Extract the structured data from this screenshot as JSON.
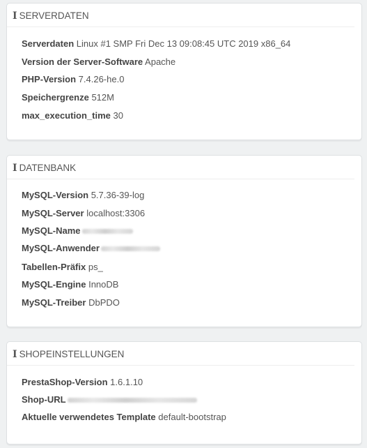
{
  "server": {
    "title": "SERVERDATEN",
    "rows": [
      {
        "label": "Serverdaten",
        "value": "Linux #1 SMP Fri Dec 13 09:08:45 UTC 2019 x86_64"
      },
      {
        "label": "Version der Server-Software",
        "value": "Apache"
      },
      {
        "label": "PHP-Version",
        "value": "7.4.26-he.0"
      },
      {
        "label": "Speichergrenze",
        "value": "512M"
      },
      {
        "label": "max_execution_time",
        "value": "30"
      }
    ]
  },
  "database": {
    "title": "DATENBANK",
    "rows": [
      {
        "label": "MySQL-Version",
        "value": "5.7.36-39-log"
      },
      {
        "label": "MySQL-Server",
        "value": "localhost:3306"
      },
      {
        "label": "MySQL-Name",
        "value": ""
      },
      {
        "label": "MySQL-Anwender",
        "value": ""
      },
      {
        "label": "Tabellen-Präfix",
        "value": "ps_"
      },
      {
        "label": "MySQL-Engine",
        "value": "InnoDB"
      },
      {
        "label": "MySQL-Treiber",
        "value": "DbPDO"
      }
    ]
  },
  "shop": {
    "title": "SHOPEINSTELLUNGEN",
    "rows": [
      {
        "label": "PrestaShop-Version",
        "value": "1.6.1.10"
      },
      {
        "label": "Shop-URL",
        "value": ""
      },
      {
        "label": "Aktuelle verwendetes Template",
        "value": "default-bootstrap"
      }
    ]
  }
}
